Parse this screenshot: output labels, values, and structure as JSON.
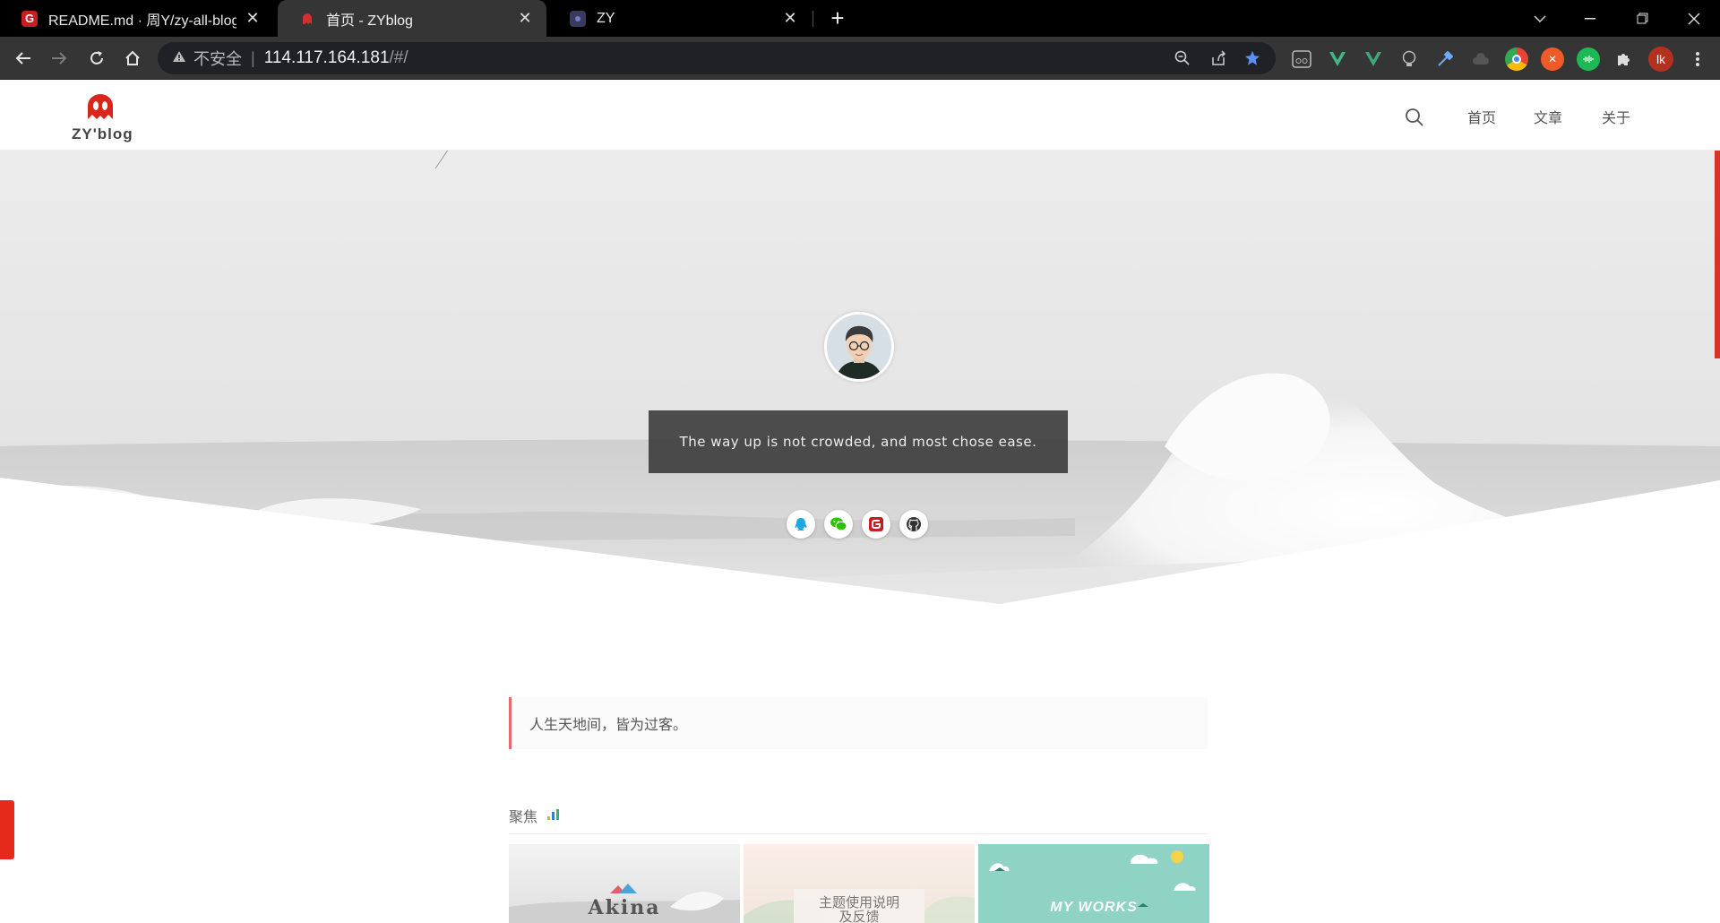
{
  "browser": {
    "tabs": [
      {
        "title": "README.md · 周Y/zy-all-blog",
        "favicon": "G",
        "favicon_color": "#c71d23"
      },
      {
        "title": "首页 - ZYblog",
        "favicon": "ghost",
        "favicon_color": "#d32f2f"
      },
      {
        "title": "ZY",
        "favicon": "dot",
        "favicon_color": "#3a3a5c"
      }
    ],
    "address": {
      "security": "不安全",
      "separator": "|",
      "host": "114.117.164.181",
      "path": "/#/"
    },
    "profile_initials": "lk"
  },
  "site": {
    "logo_text": "ZY'blog",
    "nav": [
      "首页",
      "文章",
      "关于"
    ],
    "motto": "The way up is not crowded, and most chose ease.",
    "socials": [
      "qq-icon",
      "wechat-icon",
      "gitee-icon",
      "github-icon"
    ],
    "notice": "人生天地间，皆为过客。",
    "focus_title": "聚焦",
    "cards": [
      {
        "label": "Akina"
      },
      {
        "label": "主题使用说明",
        "label2": "及反馈"
      },
      {
        "label": "MY WORKS"
      }
    ]
  }
}
